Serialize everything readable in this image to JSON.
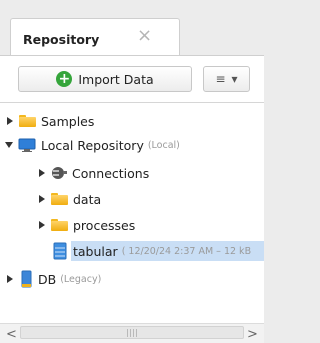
{
  "tab": {
    "title": "Repository",
    "close_glyph": "×"
  },
  "toolbar": {
    "import_label": "Import Data",
    "menu_glyph": "≡",
    "menu_arrow": "▾"
  },
  "tree": [
    {
      "label": "Samples",
      "detail": ""
    },
    {
      "label": "Local Repository",
      "detail": "(Local)"
    },
    {
      "label": "Connections",
      "detail": ""
    },
    {
      "label": "data",
      "detail": ""
    },
    {
      "label": "processes",
      "detail": ""
    },
    {
      "label": "tabular",
      "detail": "( 12/20/24 2:37 AM – 12 kB"
    },
    {
      "label": "DB",
      "detail": "(Legacy)"
    }
  ],
  "scrollbar": {
    "left_glyph": "<",
    "right_glyph": ">"
  },
  "colors": {
    "selection": "#c9def5",
    "plus_green": "#35a53b",
    "folder_yellow": "#f3b81f"
  }
}
